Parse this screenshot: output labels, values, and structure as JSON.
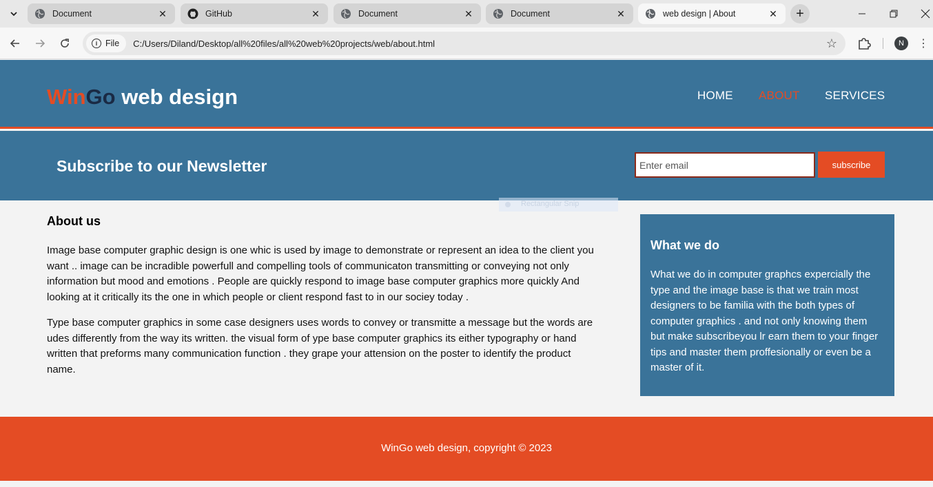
{
  "browser": {
    "tabs": [
      {
        "title": "Document",
        "icon": "globe-icon",
        "active": false
      },
      {
        "title": "GitHub",
        "icon": "github-icon",
        "active": false
      },
      {
        "title": "Document",
        "icon": "globe-icon",
        "active": false
      },
      {
        "title": "Document",
        "icon": "globe-icon",
        "active": false
      },
      {
        "title": "web design | About",
        "icon": "globe-icon",
        "active": true
      }
    ],
    "site_info_label": "File",
    "url": "C:/Users/Diland/Desktop/all%20files/all%20web%20projects/web/about.html",
    "profile_initial": "N"
  },
  "header": {
    "logo_part1": "Win",
    "logo_part2": "Go",
    "logo_rest": " web design",
    "nav": [
      {
        "label": "HOME",
        "current": false
      },
      {
        "label": "ABOUT",
        "current": true
      },
      {
        "label": "SERVICES",
        "current": false
      }
    ]
  },
  "newsletter": {
    "title": "Subscribe to our Newsletter",
    "email_placeholder": "Enter email",
    "button_label": "subscribe"
  },
  "overlay": {
    "label": "Rectangular Snip"
  },
  "main": {
    "heading": "About us",
    "paragraphs": [
      "Image base computer graphic design is one whic is used by image to demonstrate or represent an idea to the client you want .. image can be incradible powerfull and compelling tools of communicaton transmitting or conveying not only information but mood and emotions . People are quickly respond to image base computer graphics more quickly And looking at it critically its the one in which people or client respond fast to in our sociey today .",
      "Type base computer graphics in some case designers uses words to convey or transmitte a message but the words are udes differently from the way its written. the visual form of ype base computer graphics its either typography or hand written that preforms many communication function . they grape your attension on the poster to identify the product name."
    ]
  },
  "sidebar": {
    "heading": "What we do",
    "text": "What we do in computer graphcs expercially the type and the image base is that we train most designers to be familia with the both types of computer graphics . and not only knowing them but make subscribeyou lr earn them to your finger tips and master them proffesionally or even be a master of it."
  },
  "footer": {
    "text": "WinGo web design, copyright © 2023"
  },
  "colors": {
    "primary_blue": "#3a7399",
    "accent_orange": "#e44c24",
    "logo_dark": "#1a2a44",
    "background": "#f3f3f3"
  }
}
